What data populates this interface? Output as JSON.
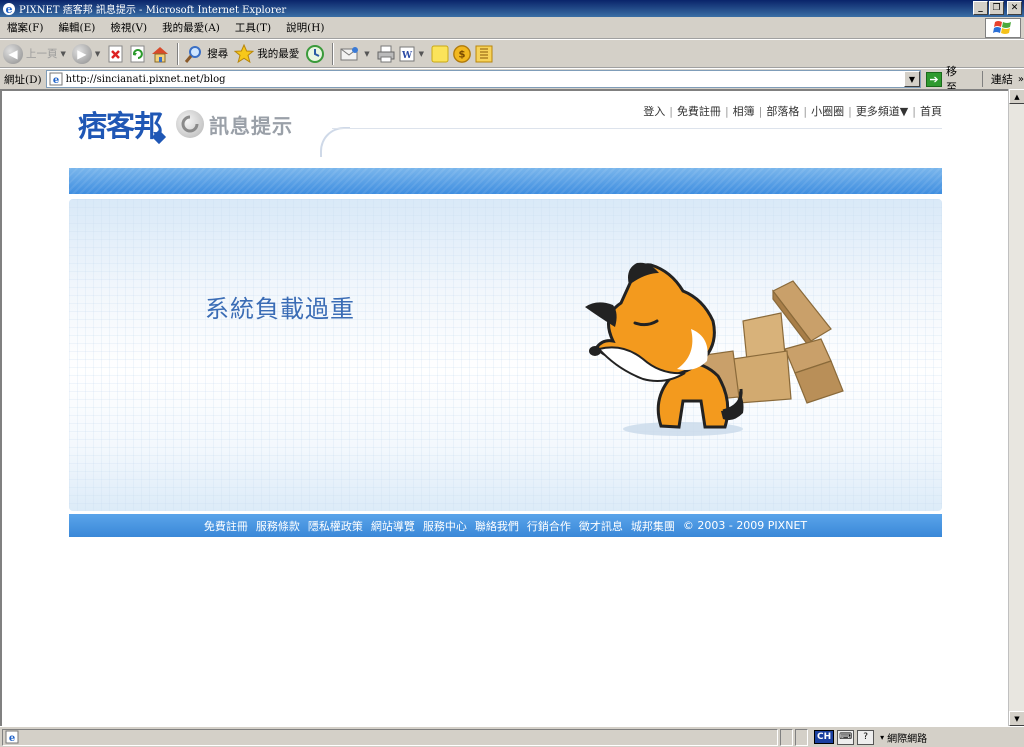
{
  "window": {
    "title": "PIXNET 痞客邦 訊息提示 - Microsoft Internet Explorer",
    "minimize_label": "_",
    "restore_label": "❐",
    "close_label": "✕"
  },
  "menu": {
    "items": [
      {
        "label": "檔案(F)"
      },
      {
        "label": "編輯(E)"
      },
      {
        "label": "檢視(V)"
      },
      {
        "label": "我的最愛(A)"
      },
      {
        "label": "工具(T)"
      },
      {
        "label": "說明(H)"
      }
    ]
  },
  "toolbar": {
    "back_label": "上一頁",
    "search_label": "搜尋",
    "favorites_label": "我的最愛"
  },
  "address": {
    "label": "網址(D)",
    "url": "http://sincianati.pixnet.net/blog",
    "go_label": "移至",
    "links_label": "連結"
  },
  "page": {
    "logo_text": "痞客邦",
    "notice_label": "訊息提示",
    "nav": [
      {
        "label": "登入"
      },
      {
        "label": "免費註冊"
      },
      {
        "label": "相簿"
      },
      {
        "label": "部落格"
      },
      {
        "label": "小圈圈"
      },
      {
        "label": "更多頻道▼"
      },
      {
        "label": "首頁"
      }
    ],
    "message": "系統負載過重",
    "footer_links": [
      {
        "label": "免費註冊"
      },
      {
        "label": "服務條款"
      },
      {
        "label": "隱私權政策"
      },
      {
        "label": "網站導覽"
      },
      {
        "label": "服務中心"
      },
      {
        "label": "聯絡我們"
      },
      {
        "label": "行銷合作"
      },
      {
        "label": "徵才訊息"
      },
      {
        "label": "城邦集團"
      }
    ],
    "copyright": "© 2003 - 2009 PIXNET"
  },
  "status": {
    "ime_mode": "CH",
    "zone_label": "網際網路"
  },
  "colors": {
    "brand_blue": "#1f57b5",
    "band_blue": "#3f8ee0",
    "message_blue": "#3a6cb5"
  }
}
